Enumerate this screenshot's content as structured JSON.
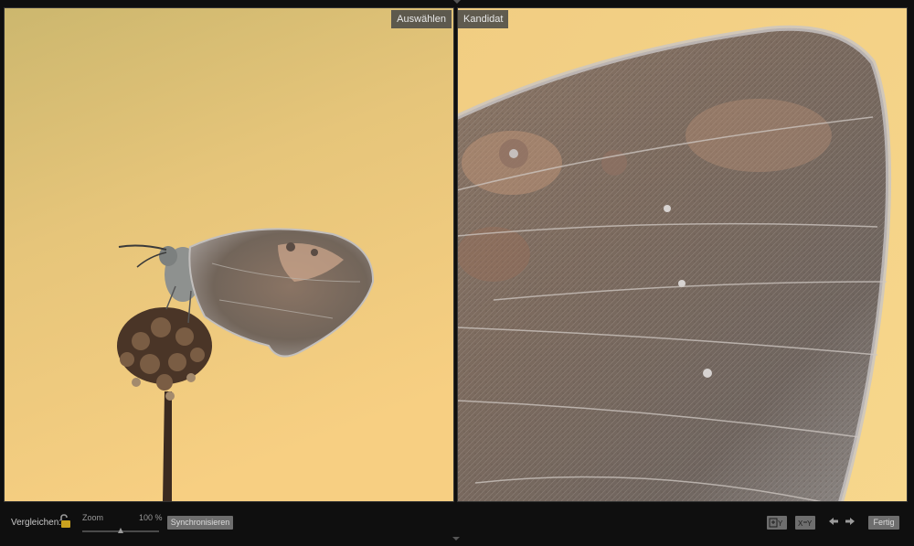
{
  "panels": {
    "select_label": "Auswählen",
    "candidate_label": "Kandidat"
  },
  "toolbar": {
    "compare_label": "Vergleichen:",
    "zoom_label": "Zoom",
    "zoom_value": "100 %",
    "zoom_level": 0.5,
    "sync_label": "Synchronisieren",
    "done_label": "Fertig"
  },
  "icons": {
    "lock": "unlock-icon",
    "swap": "swap-xy-icon",
    "copy": "copy-xy-icon",
    "prev": "arrow-left-icon",
    "next": "arrow-right-icon"
  },
  "colors": {
    "background_gold_light": "#f6cf7e",
    "background_gold_mid": "#e9c37a",
    "background_gold_dark": "#cdb66e",
    "wing_brown": "#7a6a5c",
    "wing_grey": "#a39a92"
  }
}
